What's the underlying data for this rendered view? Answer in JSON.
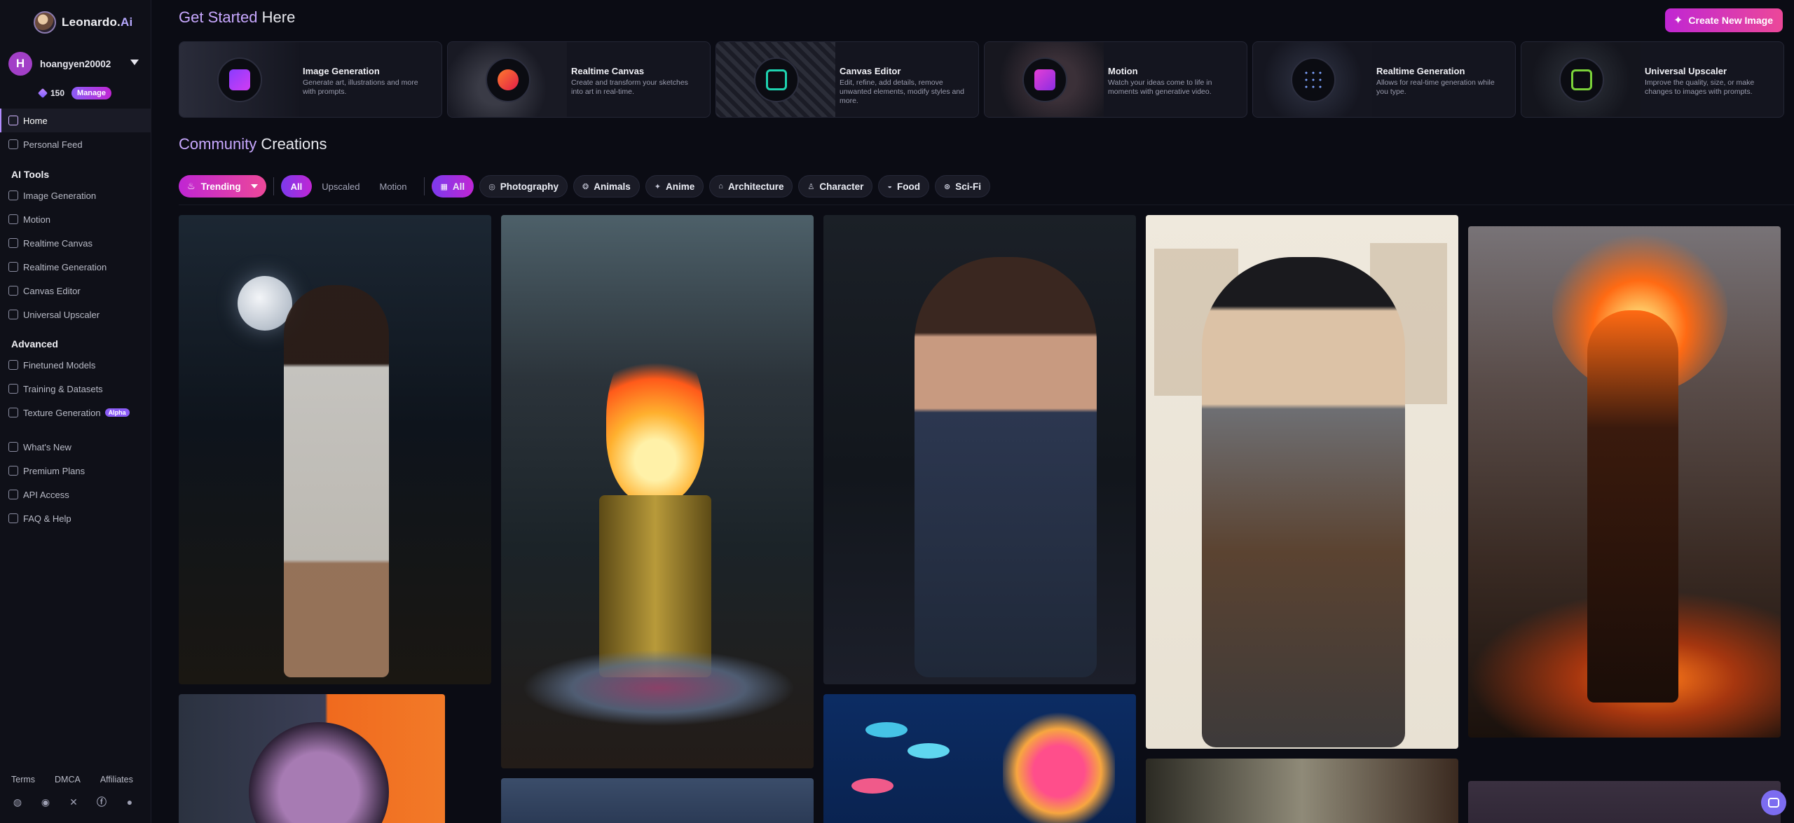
{
  "brand": {
    "name": "Leonardo.",
    "name_ai": "Ai"
  },
  "user": {
    "initial": "H",
    "username": "hoangyen20002",
    "credits": "150",
    "manage_label": "Manage"
  },
  "sidebar": {
    "home": "Home",
    "personal_feed": "Personal Feed",
    "ai_tools_title": "AI Tools",
    "ai_tools": [
      "Image Generation",
      "Motion",
      "Realtime Canvas",
      "Realtime Generation",
      "Canvas Editor",
      "Universal Upscaler"
    ],
    "advanced_title": "Advanced",
    "advanced": [
      "Finetuned Models",
      "Training & Datasets",
      "Texture Generation"
    ],
    "alpha_badge": "Alpha",
    "misc": [
      "What's New",
      "Premium Plans",
      "API Access",
      "FAQ & Help"
    ],
    "footer": [
      "Terms",
      "DMCA",
      "Affiliates"
    ],
    "social_icons": [
      "discord-icon",
      "reddit-icon",
      "x-icon",
      "facebook-icon",
      "apple-icon"
    ]
  },
  "header": {
    "title_accent": "Get Started",
    "title_rest": " Here",
    "create_button": "Create New Image"
  },
  "tools": [
    {
      "title": "Image Generation",
      "desc": "Generate art, illustrations and more with prompts.",
      "accent": "#b23cf2"
    },
    {
      "title": "Realtime Canvas",
      "desc": "Create and transform your sketches into art in real-time.",
      "accent": "#ff4d2e"
    },
    {
      "title": "Canvas Editor",
      "desc": "Edit, refine, add details, remove unwanted elements, modify styles and more.",
      "accent": "#1ed3b0"
    },
    {
      "title": "Motion",
      "desc": "Watch your ideas come to life in moments with generative video.",
      "accent": "#d63fd6"
    },
    {
      "title": "Realtime Generation",
      "desc": "Allows for real-time generation while you type.",
      "accent": "#5a7cff"
    },
    {
      "title": "Universal Upscaler",
      "desc": "Improve the quality, size, or make changes to images with prompts.",
      "accent": "#7bd23a"
    }
  ],
  "community": {
    "title_accent": "Community",
    "title_rest": " Creations"
  },
  "filters": {
    "sort": "Trending",
    "types": [
      "All",
      "Upscaled",
      "Motion"
    ],
    "categories": [
      "All",
      "Photography",
      "Animals",
      "Anime",
      "Architecture",
      "Character",
      "Food",
      "Sci-Fi"
    ]
  }
}
